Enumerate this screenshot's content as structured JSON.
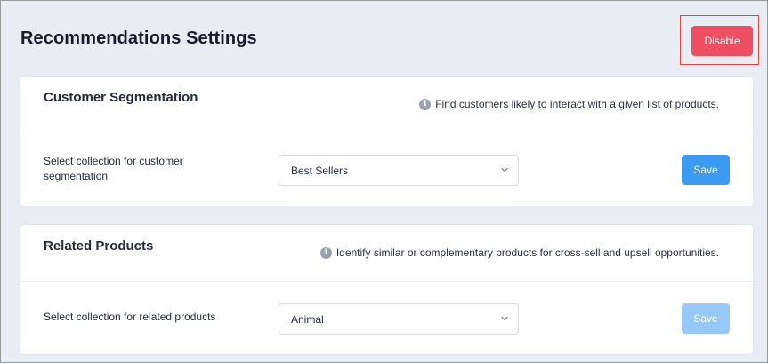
{
  "header": {
    "title": "Recommendations Settings",
    "disable_label": "Disable"
  },
  "sections": [
    {
      "title": "Customer Segmentation",
      "info_icon": "info-circle-icon",
      "info_text": "Find customers likely to interact with a given list of products.",
      "field_label": "Select collection for customer segmentation",
      "selected_collection": "Best Sellers",
      "save_label": "Save",
      "save_enabled": true
    },
    {
      "title": "Related Products",
      "info_icon": "info-circle-icon",
      "info_text": "Identify similar or complementary products for cross-sell and upsell opportunities.",
      "field_label": "Select collection for related products",
      "selected_collection": "Animal",
      "save_label": "Save",
      "save_enabled": false
    }
  ],
  "colors": {
    "disable_button": "#ef4e62",
    "save_active": "#3d9af3",
    "save_disabled": "#97c9f8",
    "highlight_outline": "#e0463e",
    "page_background": "#e8edf4"
  }
}
